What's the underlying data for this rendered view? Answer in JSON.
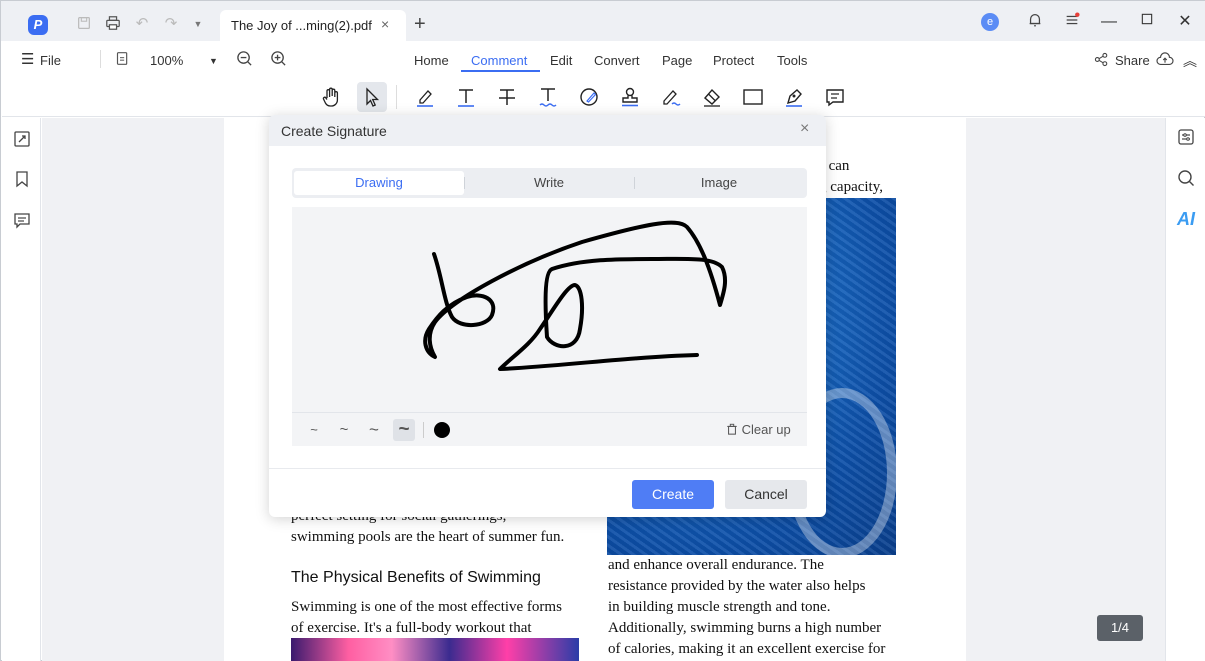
{
  "titlebar": {
    "tab_title": "The Joy of ...ming(2).pdf",
    "tab_close": "×",
    "tab_add": "+",
    "avatar_letter": "e"
  },
  "menubar": {
    "file_label": "File",
    "zoom": "100%",
    "tabs": [
      "Home",
      "Comment",
      "Edit",
      "Convert",
      "Page",
      "Protect",
      "Tools"
    ],
    "active_tab": "Comment",
    "share_label": "Share"
  },
  "toolbar": {
    "tools": [
      "hand-icon",
      "select-arrow-icon",
      "highlight-icon",
      "text-icon",
      "strikethrough-icon",
      "underline-icon",
      "shape-icon",
      "stamp-icon",
      "area-highlight-icon",
      "eraser-icon",
      "rectangle-icon",
      "pen-icon",
      "sticky-note-icon"
    ]
  },
  "document": {
    "right_top_1": "s can",
    "right_top_2": "g capacity,",
    "left_line_1": "perfect setting for social gatherings,",
    "left_line_2": "swimming pools are the heart of summer fun.",
    "heading": "The Physical Benefits of Swimming",
    "left_line_3": "Swimming is one of the most effective forms",
    "left_line_4": "of exercise. It's a full-body workout that",
    "right_line_1": "and enhance overall endurance. The",
    "right_line_2": "resistance provided by the water also helps",
    "right_line_3": "in building muscle strength and tone.",
    "right_line_4": "Additionally, swimming burns a high number",
    "right_line_5": "of calories, making it an excellent exercise for",
    "page_indicator": "1/4"
  },
  "dialog": {
    "title": "Create Signature",
    "close": "×",
    "tabs": [
      "Drawing",
      "Write",
      "Image"
    ],
    "active_tab": "Drawing",
    "stroke_options": [
      "~",
      "~",
      "~",
      "~"
    ],
    "selected_stroke": 3,
    "pen_color": "#000000",
    "clear_label": "Clear up",
    "create_label": "Create",
    "cancel_label": "Cancel"
  },
  "colors": {
    "accent": "#3b6df2",
    "primary_button": "#4f7df5"
  }
}
